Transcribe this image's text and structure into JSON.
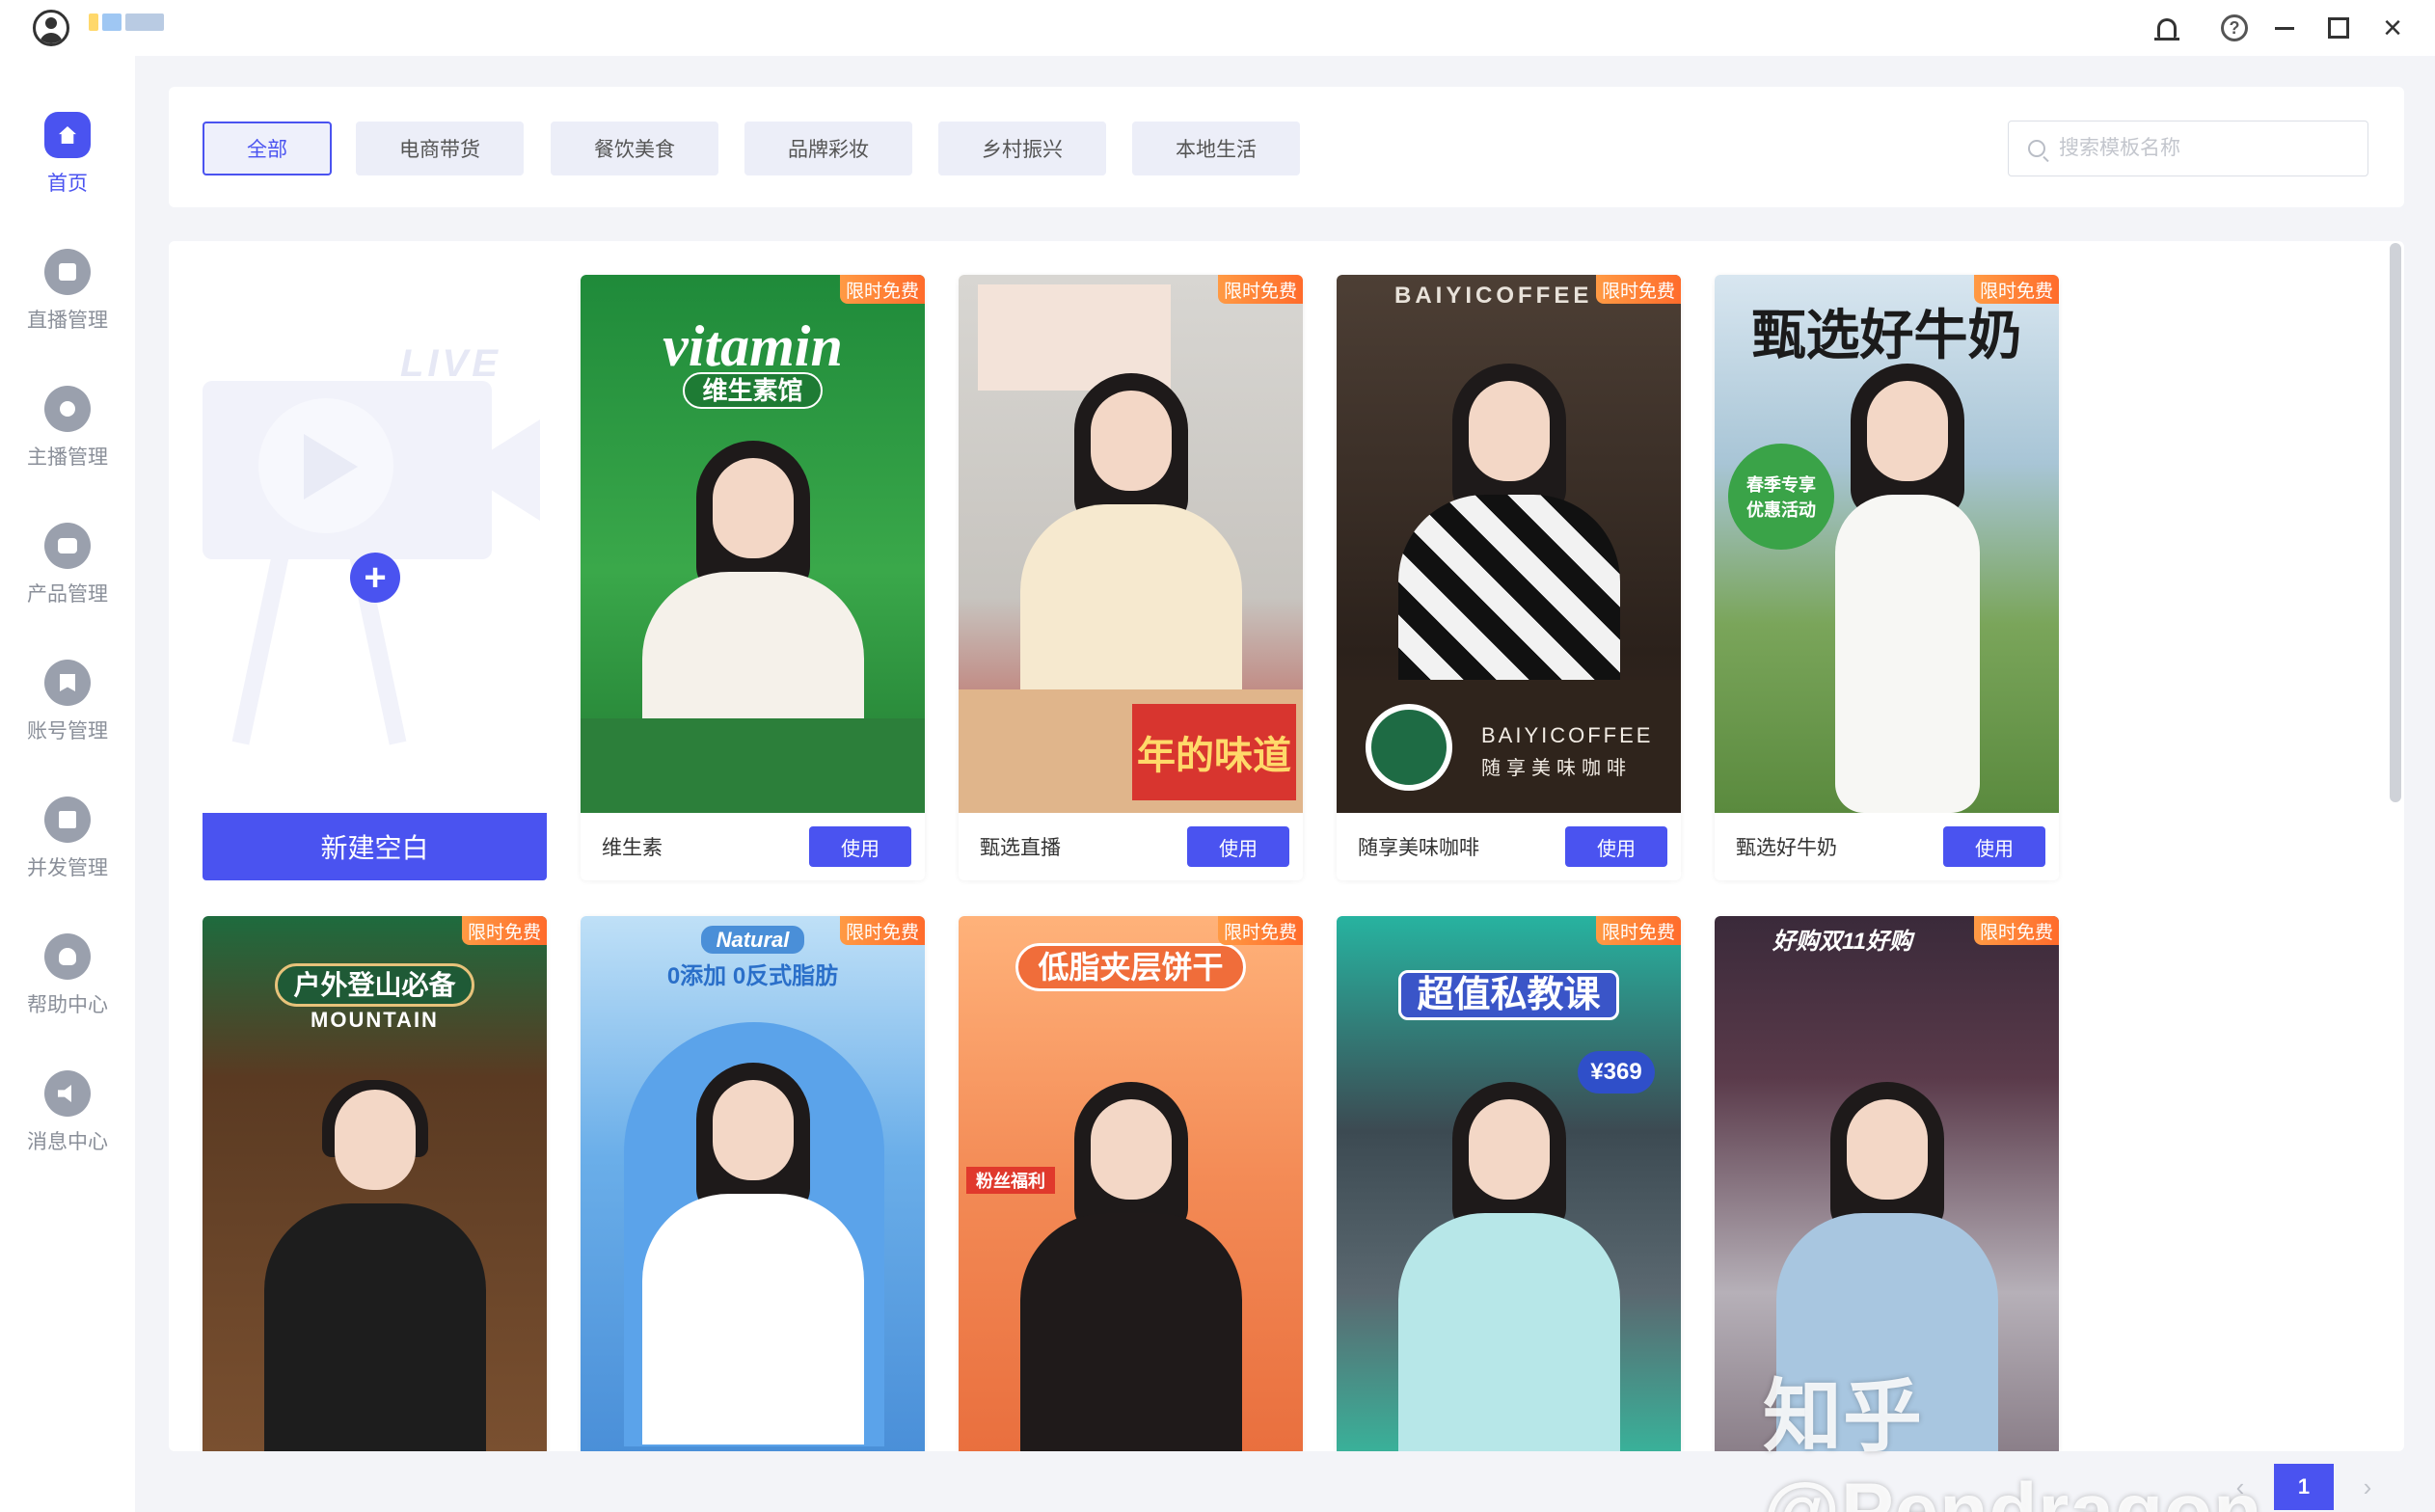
{
  "sidebar": {
    "items": [
      {
        "label": "首页",
        "icon": "home-icon",
        "active": true
      },
      {
        "label": "直播管理",
        "icon": "live-icon"
      },
      {
        "label": "主播管理",
        "icon": "user-icon"
      },
      {
        "label": "产品管理",
        "icon": "bag-icon"
      },
      {
        "label": "账号管理",
        "icon": "bookmark-icon"
      },
      {
        "label": "并发管理",
        "icon": "stack-icon"
      },
      {
        "label": "帮助中心",
        "icon": "bulb-icon"
      },
      {
        "label": "消息中心",
        "icon": "speaker-icon"
      }
    ]
  },
  "filters": {
    "tabs": [
      "全部",
      "电商带货",
      "餐饮美食",
      "品牌彩妆",
      "乡村振兴",
      "本地生活"
    ],
    "active": "全部",
    "search_placeholder": "搜索模板名称"
  },
  "blank_card": {
    "decor_text": "LIVE",
    "button_label": "新建空白"
  },
  "cards": [
    {
      "name": "维生素",
      "badge": "限时免费",
      "use_label": "使用",
      "poster_title": "vitamin",
      "poster_sub": "维生素馆",
      "bg": "#2a8f3a"
    },
    {
      "name": "甄选直播",
      "badge": "限时免费",
      "use_label": "使用",
      "poster_title": "年的味道",
      "bg": "#d9d4cc"
    },
    {
      "name": "随享美味咖啡",
      "badge": "限时免费",
      "use_label": "使用",
      "poster_title": "BAIYICOFFEE",
      "poster_sub": "随享美味咖啡",
      "bg": "#3b2c22"
    },
    {
      "name": "甄选好牛奶",
      "badge": "限时免费",
      "use_label": "使用",
      "poster_title": "甄选好牛奶",
      "poster_sub": "春季专享 优惠活动",
      "bg": "#6f9a52"
    },
    {
      "name": "",
      "badge": "限时免费",
      "poster_title": "户外登山必备",
      "poster_sub": "MOUNTAIN",
      "bg": "#6b4327"
    },
    {
      "name": "",
      "badge": "限时免费",
      "poster_title": "Natural",
      "poster_sub": "0添加 0反式脂肪",
      "bg": "#7fb8ec"
    },
    {
      "name": "",
      "badge": "限时免费",
      "poster_title": "低脂夹层饼干",
      "poster_sub": "粉丝福利",
      "bg": "#f08a55"
    },
    {
      "name": "",
      "badge": "限时免费",
      "poster_title": "超值私教课",
      "poster_sub": "¥369",
      "bg": "#2fa79a"
    },
    {
      "name": "",
      "badge": "限时免费",
      "poster_title": "好购双11好购",
      "bg": "#3a2e3d"
    }
  ],
  "pagination": {
    "prev": "‹",
    "current": "1",
    "next": "›"
  },
  "watermark": "知乎 @Pendragon",
  "colors": {
    "accent": "#4a53f0",
    "badge": "#ff7a33"
  }
}
